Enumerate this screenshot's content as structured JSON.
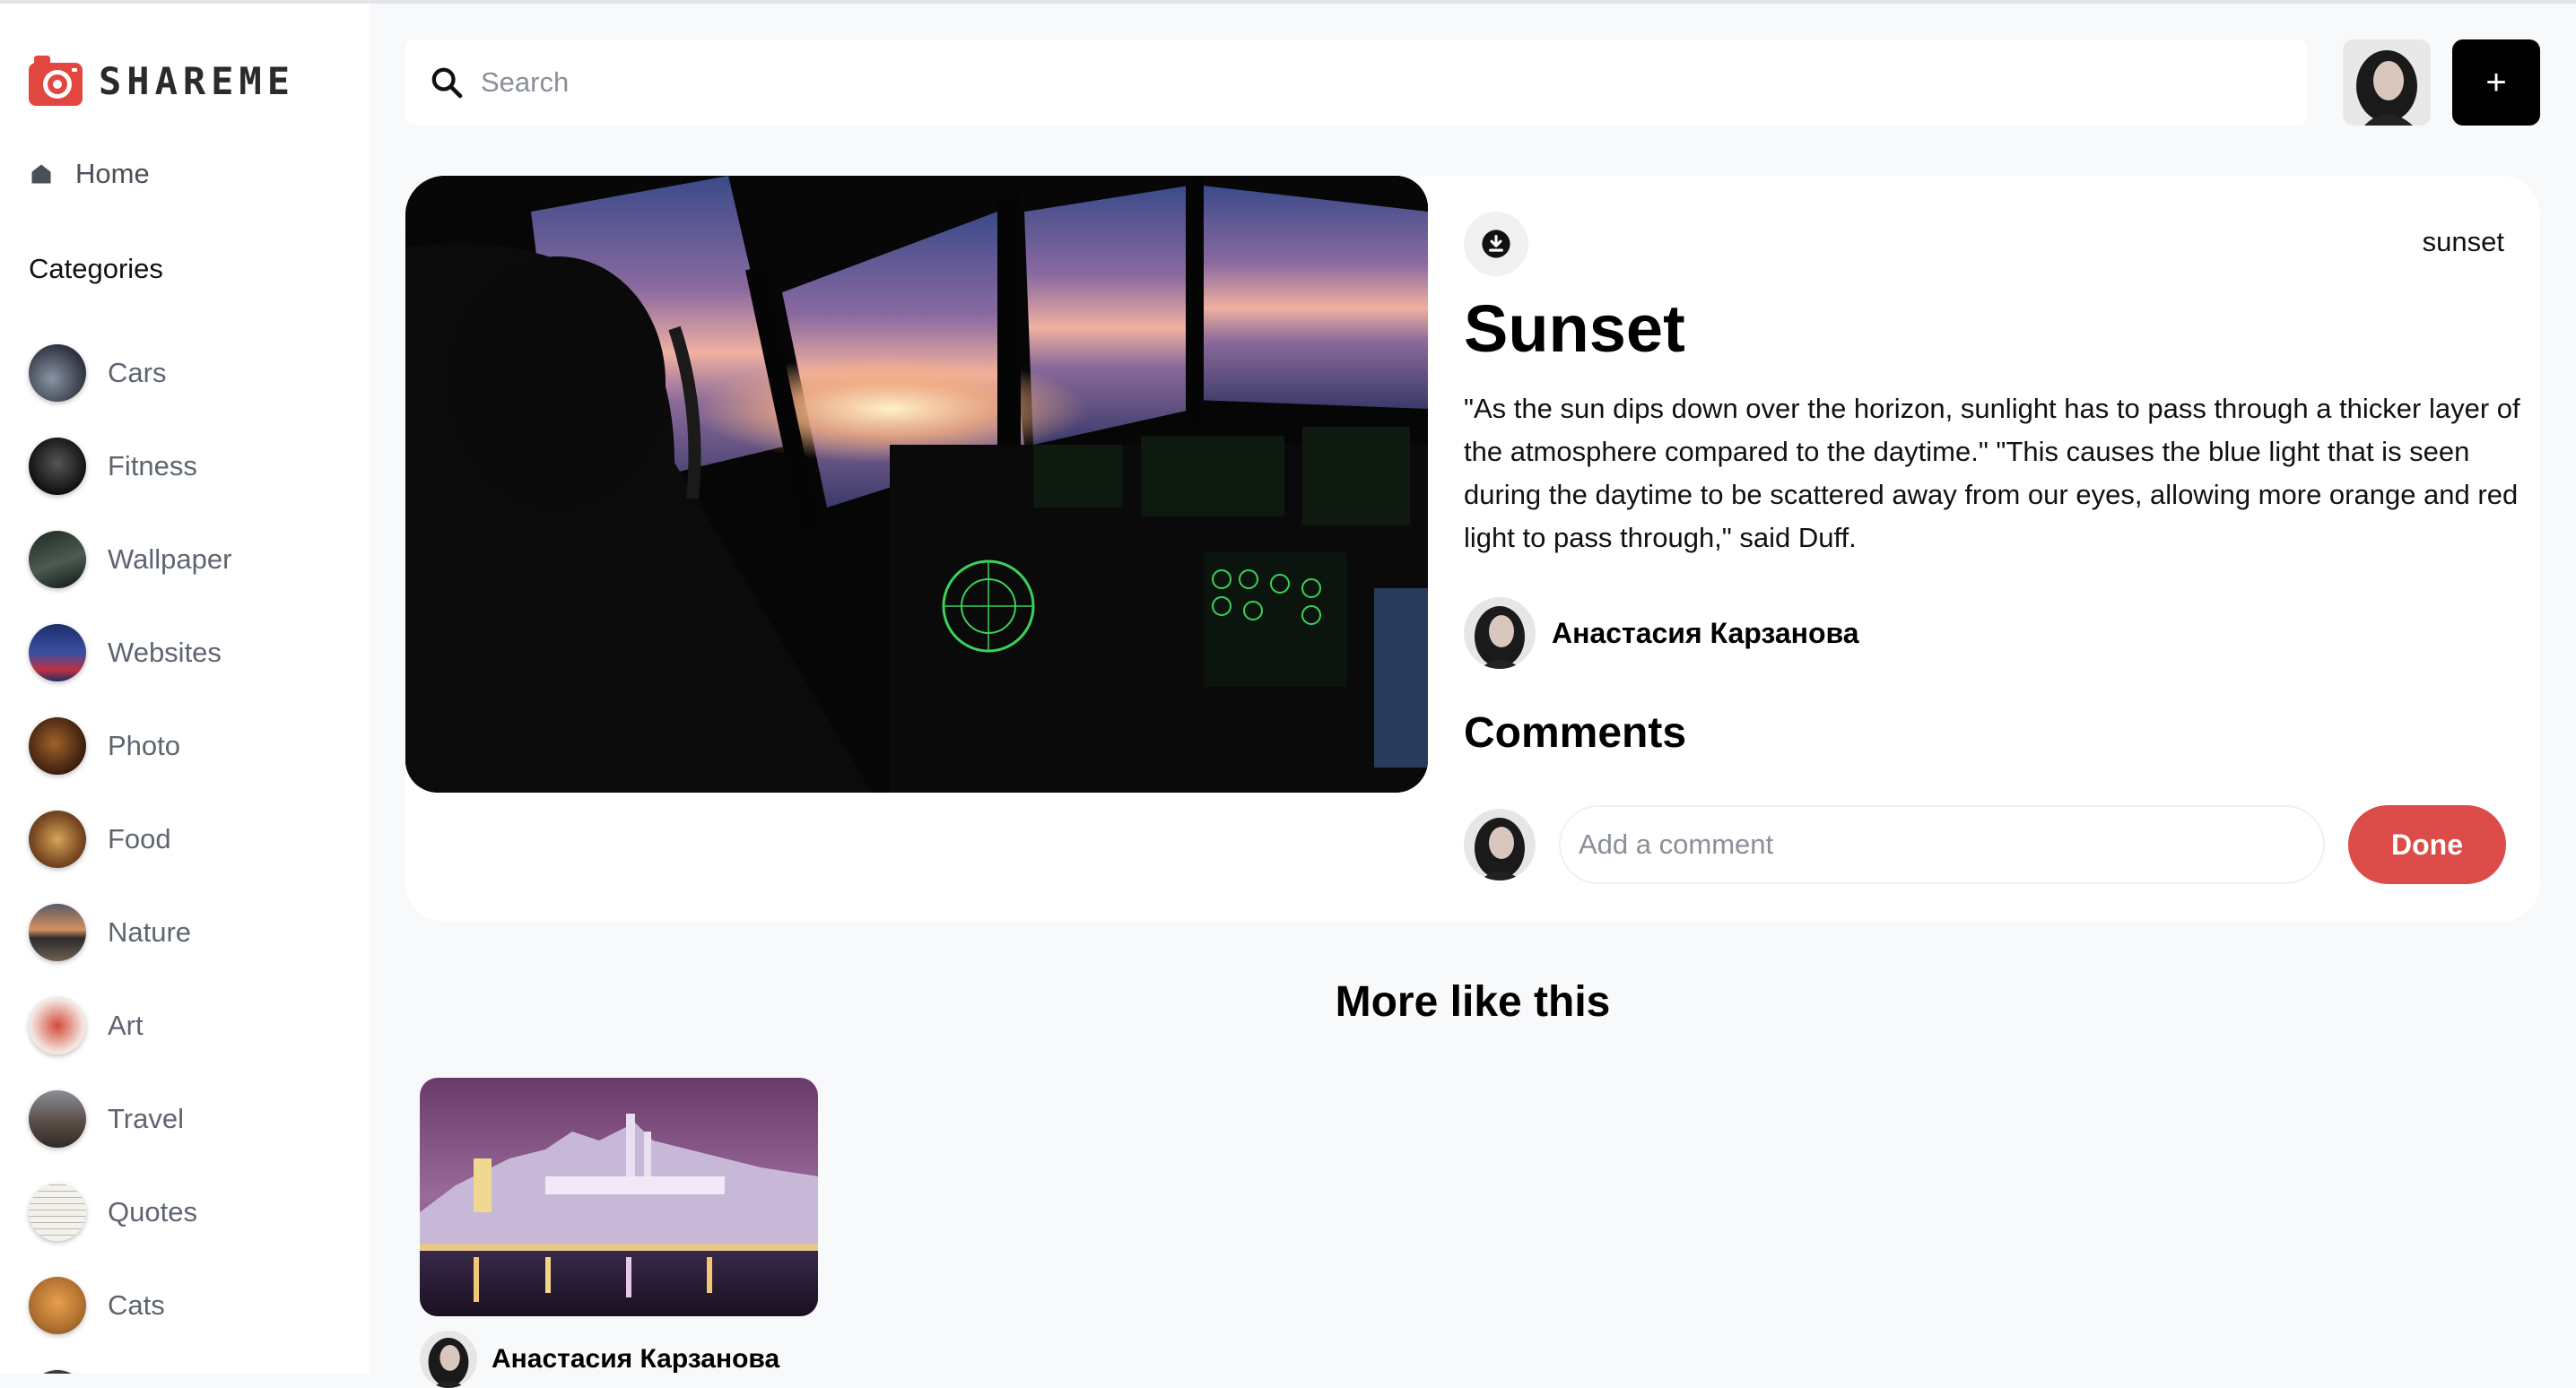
{
  "app": {
    "name": "SHAREME",
    "brand_color": "#e2473f",
    "accent_button_color": "#dc4c48"
  },
  "sidebar": {
    "home_label": "Home",
    "categories_title": "Categories",
    "categories": [
      {
        "label": "Cars",
        "icon": "cars-thumbnail"
      },
      {
        "label": "Fitness",
        "icon": "fitness-thumbnail"
      },
      {
        "label": "Wallpaper",
        "icon": "wallpaper-thumbnail"
      },
      {
        "label": "Websites",
        "icon": "websites-thumbnail"
      },
      {
        "label": "Photo",
        "icon": "photo-thumbnail"
      },
      {
        "label": "Food",
        "icon": "food-thumbnail"
      },
      {
        "label": "Nature",
        "icon": "nature-thumbnail"
      },
      {
        "label": "Art",
        "icon": "art-thumbnail"
      },
      {
        "label": "Travel",
        "icon": "travel-thumbnail"
      },
      {
        "label": "Quotes",
        "icon": "quotes-thumbnail"
      },
      {
        "label": "Cats",
        "icon": "cats-thumbnail"
      }
    ]
  },
  "header": {
    "search_placeholder": "Search",
    "add_button_label": "+"
  },
  "pin": {
    "destination": "sunset",
    "title": "Sunset",
    "about": "\"As the sun dips down over the horizon, sunlight has to pass through a thicker layer of the atmosphere compared to the daytime.\" \"This causes the blue light that is seen during the daytime to be scattered away from our eyes, allowing more orange and red light to pass through,\" said Duff.",
    "author_name": "Анастасия Карзанова",
    "comments_title": "Comments",
    "comment_placeholder": "Add a comment",
    "done_label": "Done"
  },
  "more_like_this": {
    "title": "More like this",
    "items": [
      {
        "author_name": "Анастасия Карзанова"
      }
    ]
  }
}
